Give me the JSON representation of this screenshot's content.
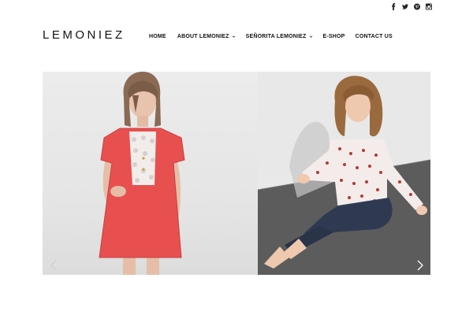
{
  "social": [
    {
      "name": "facebook-icon"
    },
    {
      "name": "twitter-icon"
    },
    {
      "name": "pinterest-icon"
    },
    {
      "name": "instagram-icon"
    }
  ],
  "brand": {
    "logo_text": "LEMONIEZ"
  },
  "nav": {
    "home": "HOME",
    "about": "ABOUT LEMONIEZ",
    "senorita": "SEÑORITA LEMONIEZ",
    "eshop": "E-SHOP",
    "contact": "CONTACT US"
  },
  "colors": {
    "text": "#111111",
    "dress": "#e8504f",
    "denim": "#2f3a52",
    "floor": "#5a5a5a"
  },
  "slider": {
    "slides": [
      {
        "name": "girl-red-dress-photo"
      },
      {
        "name": "girl-patterned-shirt-jeans-photo"
      }
    ]
  }
}
